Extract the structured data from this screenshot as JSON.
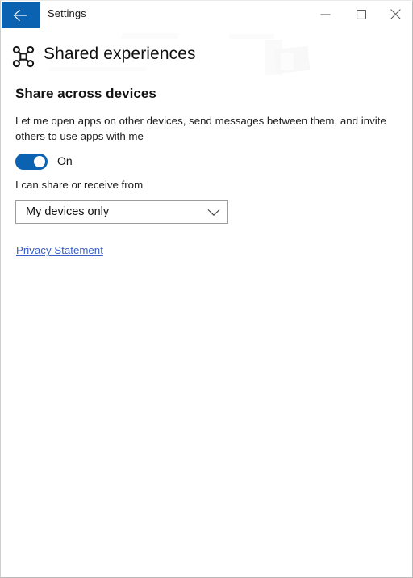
{
  "window": {
    "titlebar": {
      "app_title": "Settings",
      "back_icon": "back-arrow-icon",
      "minimize_icon": "minimize-icon",
      "maximize_icon": "maximize-icon",
      "close_icon": "close-icon",
      "back_button_color": "#0a62b0"
    },
    "header": {
      "icon": "shared-experiences-icon",
      "title": "Shared experiences"
    },
    "main": {
      "section_heading": "Share across devices",
      "section_description": "Let me open apps on other devices, send messages between them, and invite others to use apps with me",
      "toggle": {
        "state_label": "On",
        "checked": true,
        "accent_color": "#0a62b0"
      },
      "subsection_label": "I can share or receive from",
      "dropdown": {
        "selected": "My devices only",
        "chevron_icon": "chevron-down-icon"
      },
      "privacy_link": {
        "label": "Privacy Statement",
        "color": "#3a5fc8"
      }
    }
  }
}
